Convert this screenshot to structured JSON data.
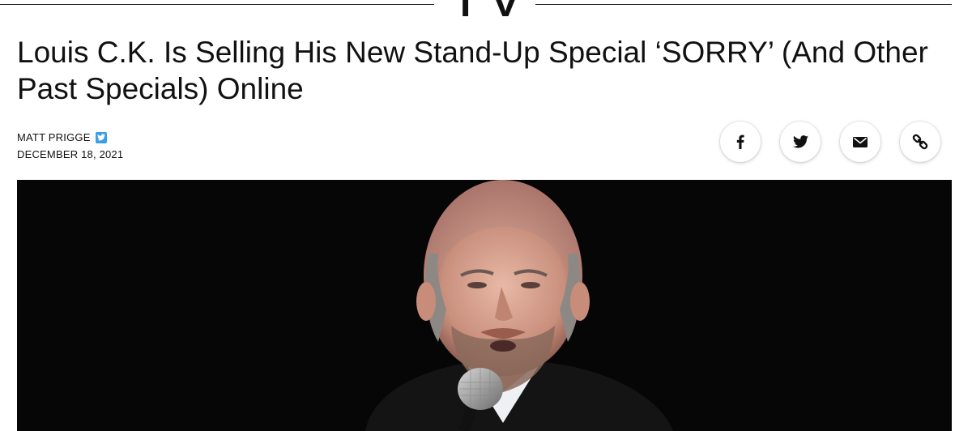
{
  "section": {
    "label": "TV"
  },
  "article": {
    "headline": "Louis C.K. Is Selling His New Stand-Up Special ‘SORRY’ (And Other Past Specials) Online",
    "author": "MATT PRIGGE",
    "date": "DECEMBER 18, 2021"
  },
  "share": {
    "buttons": [
      {
        "icon": "facebook-icon"
      },
      {
        "icon": "twitter-icon"
      },
      {
        "icon": "email-icon"
      },
      {
        "icon": "link-icon"
      }
    ]
  },
  "colors": {
    "twitter_badge": "#3a9de6",
    "text": "#111111",
    "hero_background": "#050505"
  }
}
